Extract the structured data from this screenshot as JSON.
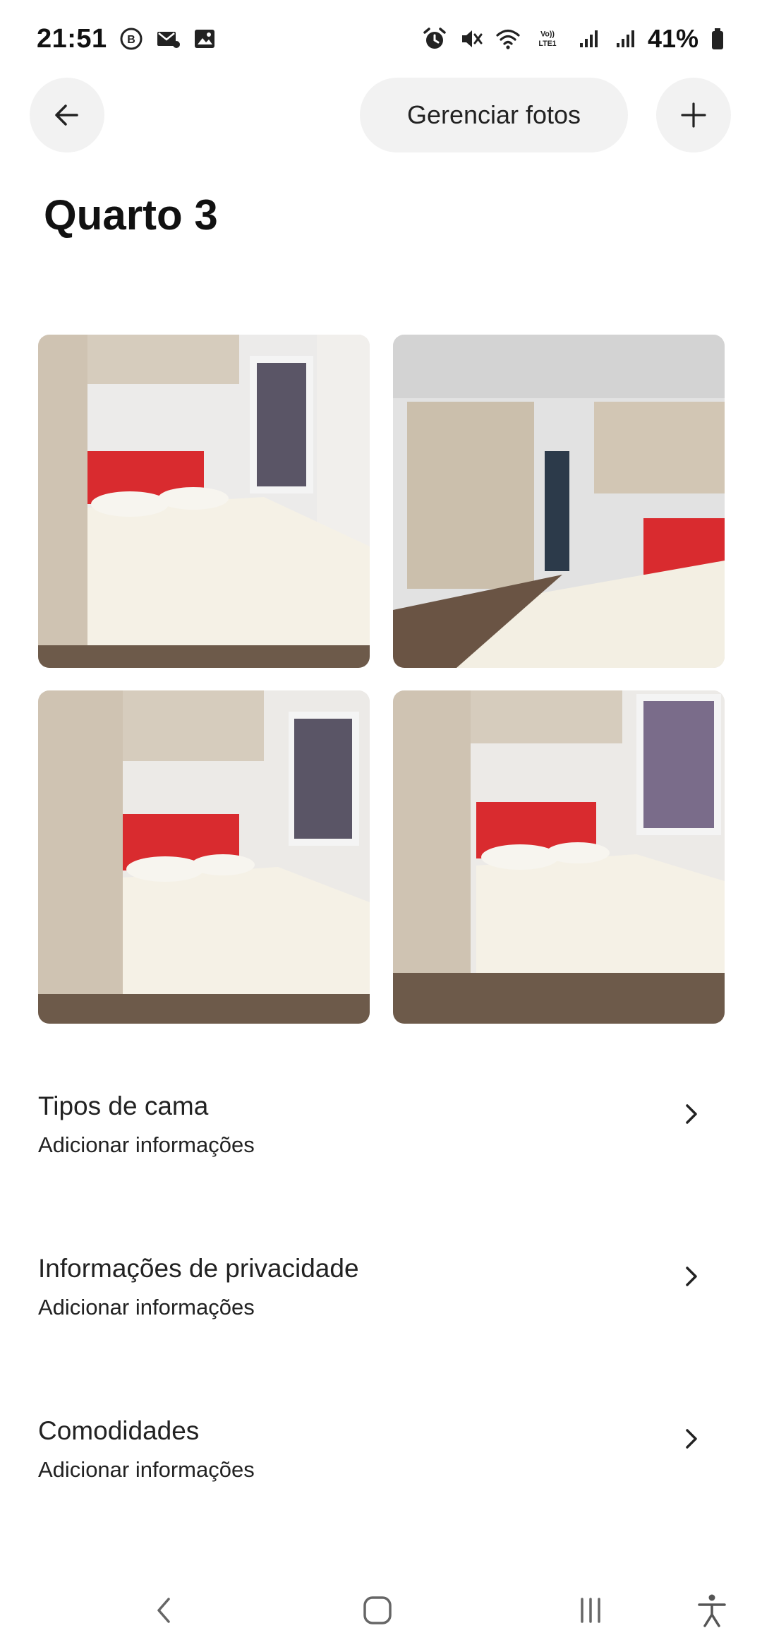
{
  "status_bar": {
    "time": "21:51",
    "left_icons": [
      "b-circle-icon",
      "mail-notification-icon",
      "image-icon"
    ],
    "right_icons": [
      "alarm-icon",
      "mute-icon",
      "wifi-icon",
      "volte-icon",
      "signal-icon",
      "signal-icon"
    ],
    "volte_label_top": "Vo))",
    "volte_label_bottom": "LTE1",
    "battery_percent": "41%"
  },
  "header": {
    "back_icon": "arrow-left-icon",
    "manage_photos_label": "Gerenciar fotos",
    "add_icon": "plus-icon"
  },
  "page_title": "Quarto 3",
  "photos": [
    {
      "alt": "bedroom-photo"
    },
    {
      "alt": "bedroom-photo"
    },
    {
      "alt": "bedroom-photo"
    },
    {
      "alt": "bedroom-photo"
    }
  ],
  "sections": [
    {
      "title": "Tipos de cama",
      "subtitle": "Adicionar informações"
    },
    {
      "title": "Informações de privacidade",
      "subtitle": "Adicionar informações"
    },
    {
      "title": "Comodidades",
      "subtitle": "Adicionar informações"
    }
  ],
  "nav_bar": {
    "icons": [
      "nav-back-icon",
      "nav-home-icon",
      "nav-recent-apps-icon",
      "accessibility-icon"
    ]
  },
  "colors": {
    "background": "#ffffff",
    "button_bg": "#f2f2f2",
    "text": "#222222",
    "headboard_red": "#d92b2f"
  }
}
